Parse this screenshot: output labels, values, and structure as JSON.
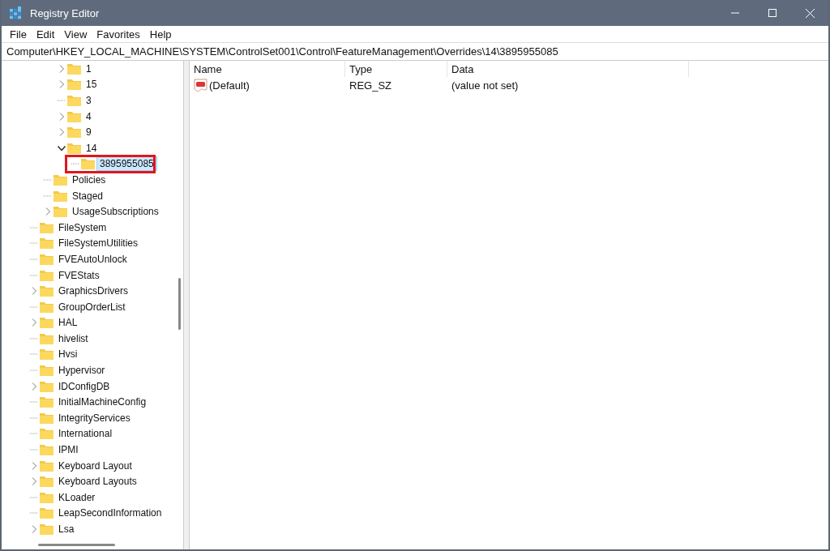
{
  "window": {
    "title": "Registry Editor"
  },
  "menu": [
    {
      "label": "File"
    },
    {
      "label": "Edit"
    },
    {
      "label": "View"
    },
    {
      "label": "Favorites"
    },
    {
      "label": "Help"
    }
  ],
  "address": "Computer\\HKEY_LOCAL_MACHINE\\SYSTEM\\ControlSet001\\Control\\FeatureManagement\\Overrides\\14\\3895955085",
  "tree": [
    {
      "children": [
        {
          "children": [
            {
              "label": "1",
              "has_children": true,
              "expanded": false,
              "selected": false,
              "highlighted": false
            },
            {
              "label": "15",
              "has_children": true,
              "expanded": false,
              "selected": false,
              "highlighted": false
            },
            {
              "label": "3",
              "has_children": false,
              "selected": false,
              "highlighted": false
            },
            {
              "label": "4",
              "has_children": true,
              "expanded": false,
              "selected": false,
              "highlighted": false
            },
            {
              "label": "9",
              "has_children": true,
              "expanded": false,
              "selected": false,
              "highlighted": false
            },
            {
              "label": "14",
              "has_children": true,
              "expanded": true,
              "selected": false,
              "highlighted": false,
              "children": [
                {
                  "label": "3895955085",
                  "has_children": false,
                  "selected": true,
                  "highlighted": true
                }
              ]
            }
          ]
        },
        {
          "label": "Policies",
          "has_children": false,
          "selected": false,
          "highlighted": false
        },
        {
          "label": "Staged",
          "has_children": false,
          "selected": false,
          "highlighted": false
        },
        {
          "label": "UsageSubscriptions",
          "has_children": true,
          "expanded": false,
          "selected": false,
          "highlighted": false
        }
      ]
    },
    {
      "label": "FileSystem",
      "has_children": false,
      "selected": false,
      "highlighted": false
    },
    {
      "label": "FileSystemUtilities",
      "has_children": false,
      "selected": false,
      "highlighted": false
    },
    {
      "label": "FVEAutoUnlock",
      "has_children": false,
      "selected": false,
      "highlighted": false
    },
    {
      "label": "FVEStats",
      "has_children": false,
      "selected": false,
      "highlighted": false
    },
    {
      "label": "GraphicsDrivers",
      "has_children": true,
      "expanded": false,
      "selected": false,
      "highlighted": false
    },
    {
      "label": "GroupOrderList",
      "has_children": false,
      "selected": false,
      "highlighted": false
    },
    {
      "label": "HAL",
      "has_children": true,
      "expanded": false,
      "selected": false,
      "highlighted": false
    },
    {
      "label": "hivelist",
      "has_children": false,
      "selected": false,
      "highlighted": false
    },
    {
      "label": "Hvsi",
      "has_children": false,
      "selected": false,
      "highlighted": false
    },
    {
      "label": "Hypervisor",
      "has_children": false,
      "selected": false,
      "highlighted": false
    },
    {
      "label": "IDConfigDB",
      "has_children": true,
      "expanded": false,
      "selected": false,
      "highlighted": false
    },
    {
      "label": "InitialMachineConfig",
      "has_children": false,
      "selected": false,
      "highlighted": false
    },
    {
      "label": "IntegrityServices",
      "has_children": false,
      "selected": false,
      "highlighted": false
    },
    {
      "label": "International",
      "has_children": false,
      "selected": false,
      "highlighted": false
    },
    {
      "label": "IPMI",
      "has_children": false,
      "selected": false,
      "highlighted": false
    },
    {
      "label": "Keyboard Layout",
      "has_children": true,
      "expanded": false,
      "selected": false,
      "highlighted": false
    },
    {
      "label": "Keyboard Layouts",
      "has_children": true,
      "expanded": false,
      "selected": false,
      "highlighted": false
    },
    {
      "label": "KLoader",
      "has_children": false,
      "selected": false,
      "highlighted": false
    },
    {
      "label": "LeapSecondInformation",
      "has_children": false,
      "selected": false,
      "highlighted": false
    },
    {
      "label": "Lsa",
      "has_children": true,
      "expanded": false,
      "selected": false,
      "highlighted": false
    }
  ],
  "values_table": {
    "columns": [
      "Name",
      "Type",
      "Data"
    ],
    "rows": [
      {
        "kind": "string",
        "name": "(Default)",
        "type": "REG_SZ",
        "data": "(value not set)"
      }
    ]
  }
}
